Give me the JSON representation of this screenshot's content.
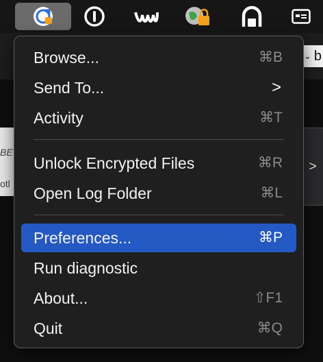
{
  "menubar": {
    "icons": [
      "app-sync-icon",
      "power-circle-icon",
      "waves-icon",
      "locked-globe-icon",
      "headphones-arch-icon",
      "window-card-icon"
    ]
  },
  "background": {
    "dropdown_text": "b",
    "card_left_texts": [
      "BE",
      "otl"
    ],
    "card_right_arrow": ">"
  },
  "menu": {
    "items": [
      {
        "label": "Browse...",
        "shortcut": "⌘B"
      },
      {
        "label": "Send To...",
        "submenu_arrow": ">"
      },
      {
        "label": "Activity",
        "shortcut": "⌘T"
      },
      {
        "label": "Unlock Encrypted Files",
        "shortcut": "⌘R"
      },
      {
        "label": "Open Log Folder",
        "shortcut": "⌘L"
      },
      {
        "label": "Preferences...",
        "shortcut": "⌘P"
      },
      {
        "label": "Run diagnostic"
      },
      {
        "label": "About...",
        "shortcut": "⇧F1"
      },
      {
        "label": "Quit",
        "shortcut": "⌘Q"
      }
    ]
  },
  "colors": {
    "highlight": "#2459c4",
    "menu_bg": "#1f1f20"
  }
}
